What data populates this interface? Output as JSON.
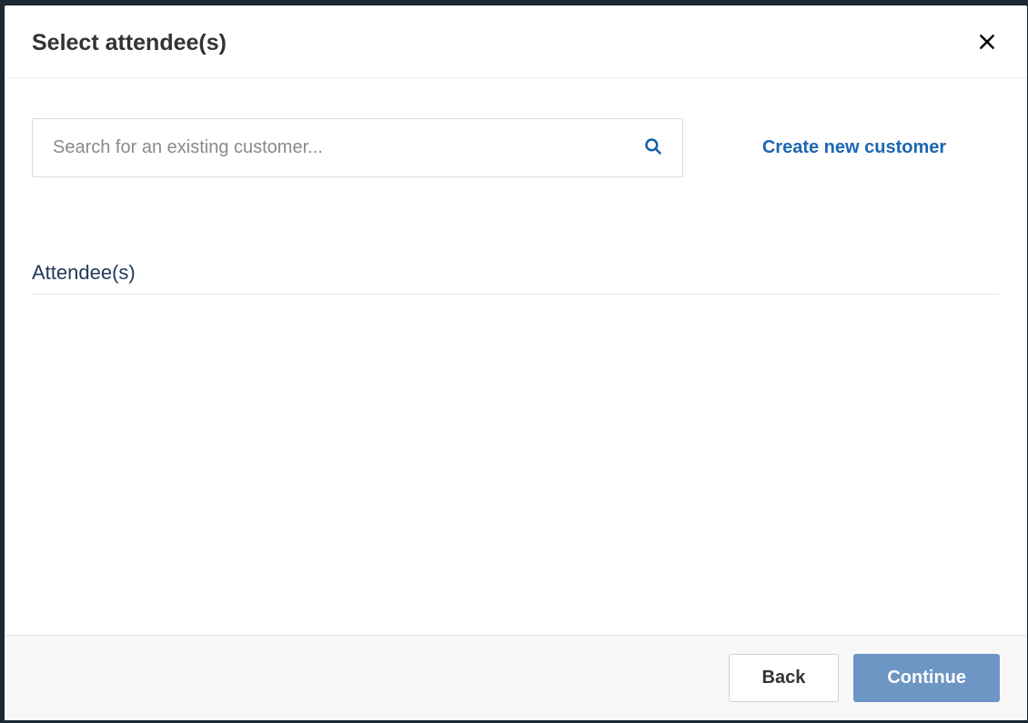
{
  "modal": {
    "title": "Select attendee(s)",
    "search": {
      "placeholder": "Search for an existing customer..."
    },
    "create_link": "Create new customer",
    "section_title": "Attendee(s)",
    "footer": {
      "back": "Back",
      "continue": "Continue"
    }
  }
}
